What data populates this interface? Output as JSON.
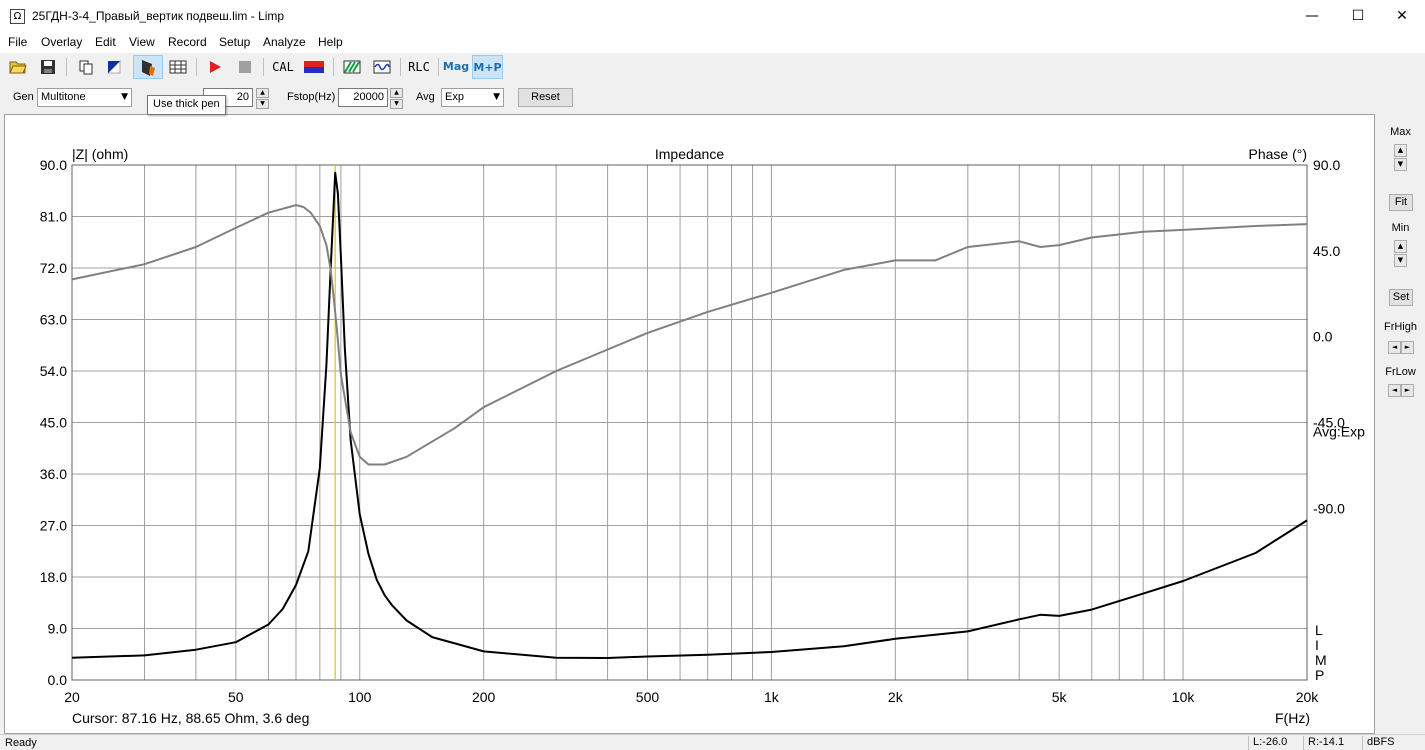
{
  "window": {
    "title": "25ГДН-3-4_Правый_вертик подвеш.lim - Limp",
    "app_icon": "Ω",
    "minimize": "—",
    "maximize": "☐",
    "close": "✕"
  },
  "menu": [
    "File",
    "Overlay",
    "Edit",
    "View",
    "Record",
    "Setup",
    "Analyze",
    "Help"
  ],
  "toolbar": {
    "cal": "CAL",
    "rlc": "RLC",
    "mag": "Mag",
    "mp": "M+P",
    "tooltip": "Use thick pen"
  },
  "params": {
    "gen_label": "Gen",
    "gen_value": "Multitone",
    "fstart_value": "20",
    "fstop_label": "Fstop(Hz)",
    "fstop_value": "20000",
    "avg_label": "Avg",
    "avg_value": "Exp",
    "reset_label": "Reset"
  },
  "right_panel": {
    "max": "Max",
    "fit": "Fit",
    "min": "Min",
    "set": "Set",
    "frhigh": "FrHigh",
    "frlow": "FrLow"
  },
  "status": {
    "ready": "Ready",
    "left": "L:-26.0",
    "right": "R:-14.1",
    "unit": "dBFS"
  },
  "chart_data": {
    "type": "line",
    "title": "Impedance",
    "ylabel_left": "|Z| (ohm)",
    "ylabel_right": "Phase (°)",
    "xlabel": "F(Hz)",
    "x_scale": "log",
    "xlim": [
      20,
      20000
    ],
    "ylim_left": [
      0,
      90
    ],
    "ylim_right": [
      -180,
      90
    ],
    "x_ticks": [
      20,
      50,
      100,
      200,
      500,
      1000,
      2000,
      5000,
      10000,
      20000
    ],
    "x_tick_labels": [
      "20",
      "50",
      "100",
      "200",
      "500",
      "1k",
      "2k",
      "5k",
      "10k",
      "20k"
    ],
    "y_tick_labels_left": [
      "0.0",
      "9.0",
      "18.0",
      "27.0",
      "36.0",
      "45.0",
      "54.0",
      "63.0",
      "72.0",
      "81.0",
      "90.0"
    ],
    "y_tick_labels_right": [
      "-90.0",
      "-45.0",
      "0.0",
      "45.0",
      "90.0"
    ],
    "y_tick_values_right": [
      -90,
      -45,
      0,
      45,
      90
    ],
    "cursor_freq": 87.16,
    "cursor_text": "Cursor: 87.16 Hz, 88.65 Ohm, 3.6 deg",
    "avg_annotation": "Avg:Exp",
    "side_letters": [
      "L",
      "I",
      "M",
      "P"
    ],
    "colors": {
      "impedance": "#000000",
      "phase": "#808080",
      "cursor": "#d8c800",
      "grid": "#a0a0a0"
    },
    "series": [
      {
        "name": "|Z| (ohm)",
        "axis": "left",
        "points": [
          [
            20,
            3.9
          ],
          [
            30,
            4.3
          ],
          [
            40,
            5.3
          ],
          [
            50,
            6.6
          ],
          [
            60,
            9.7
          ],
          [
            65,
            12.4
          ],
          [
            70,
            16.6
          ],
          [
            75,
            22.5
          ],
          [
            80,
            37
          ],
          [
            83,
            55
          ],
          [
            85,
            72
          ],
          [
            87.16,
            88.65
          ],
          [
            88.5,
            85
          ],
          [
            90,
            74
          ],
          [
            92,
            58
          ],
          [
            95,
            42
          ],
          [
            100,
            29
          ],
          [
            105,
            22
          ],
          [
            110,
            17.5
          ],
          [
            115,
            14.8
          ],
          [
            120,
            13
          ],
          [
            130,
            10.4
          ],
          [
            150,
            7.5
          ],
          [
            200,
            5
          ],
          [
            300,
            3.9
          ],
          [
            400,
            3.85
          ],
          [
            500,
            4.1
          ],
          [
            700,
            4.4
          ],
          [
            1000,
            4.9
          ],
          [
            1500,
            5.9
          ],
          [
            2000,
            7.2
          ],
          [
            3000,
            8.5
          ],
          [
            4000,
            10.6
          ],
          [
            4500,
            11.4
          ],
          [
            5000,
            11.2
          ],
          [
            6000,
            12.3
          ],
          [
            8000,
            15.1
          ],
          [
            10000,
            17.3
          ],
          [
            15000,
            22.2
          ],
          [
            20000,
            27.9
          ]
        ]
      },
      {
        "name": "Phase (°)",
        "axis": "right",
        "points": [
          [
            20,
            30
          ],
          [
            30,
            38
          ],
          [
            40,
            47
          ],
          [
            50,
            57
          ],
          [
            60,
            65
          ],
          [
            70,
            69
          ],
          [
            73,
            68
          ],
          [
            76,
            65
          ],
          [
            80,
            58
          ],
          [
            83,
            48
          ],
          [
            85,
            35
          ],
          [
            87,
            15
          ],
          [
            88,
            3.6
          ],
          [
            90,
            -20
          ],
          [
            95,
            -50
          ],
          [
            100,
            -63
          ],
          [
            105,
            -67
          ],
          [
            115,
            -67
          ],
          [
            130,
            -63
          ],
          [
            170,
            -48
          ],
          [
            200,
            -37
          ],
          [
            300,
            -18
          ],
          [
            500,
            2
          ],
          [
            700,
            13
          ],
          [
            1000,
            23
          ],
          [
            1500,
            35
          ],
          [
            2000,
            40
          ],
          [
            2500,
            40
          ],
          [
            3000,
            47
          ],
          [
            4000,
            50
          ],
          [
            4500,
            47
          ],
          [
            5000,
            48
          ],
          [
            6000,
            52
          ],
          [
            8000,
            55
          ],
          [
            10000,
            56
          ],
          [
            15000,
            58
          ],
          [
            20000,
            59
          ]
        ]
      }
    ]
  }
}
